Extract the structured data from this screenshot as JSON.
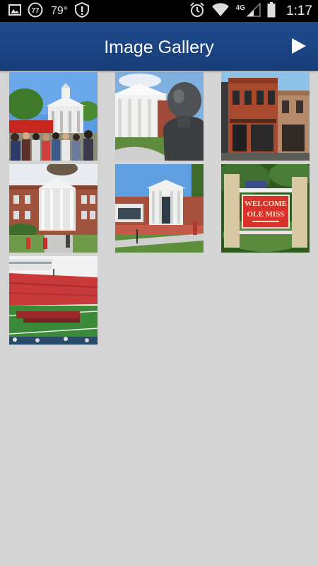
{
  "status_bar": {
    "temperature": "79°",
    "notification_count": "77",
    "network_type": "4G",
    "time": "1:17",
    "icons": [
      "gallery-notification-icon",
      "notification-count-icon",
      "alert-icon",
      "alarm-icon",
      "wifi-icon",
      "signal-icon",
      "battery-icon"
    ]
  },
  "app_bar": {
    "title": "Image Gallery",
    "action_icon": "play-icon"
  },
  "gallery": {
    "thumbnails": [
      {
        "subject": "courthouse-crowd"
      },
      {
        "subject": "lyceum-statue"
      },
      {
        "subject": "brick-storefronts"
      },
      {
        "subject": "columned-hall"
      },
      {
        "subject": "library-building"
      },
      {
        "subject": "welcome-sign"
      },
      {
        "subject": "stadium"
      }
    ],
    "sign_text_line1": "WELCOME",
    "sign_text_line2": "OLE MISS"
  },
  "colors": {
    "app_bar": "#1f4b8d",
    "background": "#d4d4d4",
    "status_bar": "#000000",
    "sign_red": "#d9322a"
  }
}
